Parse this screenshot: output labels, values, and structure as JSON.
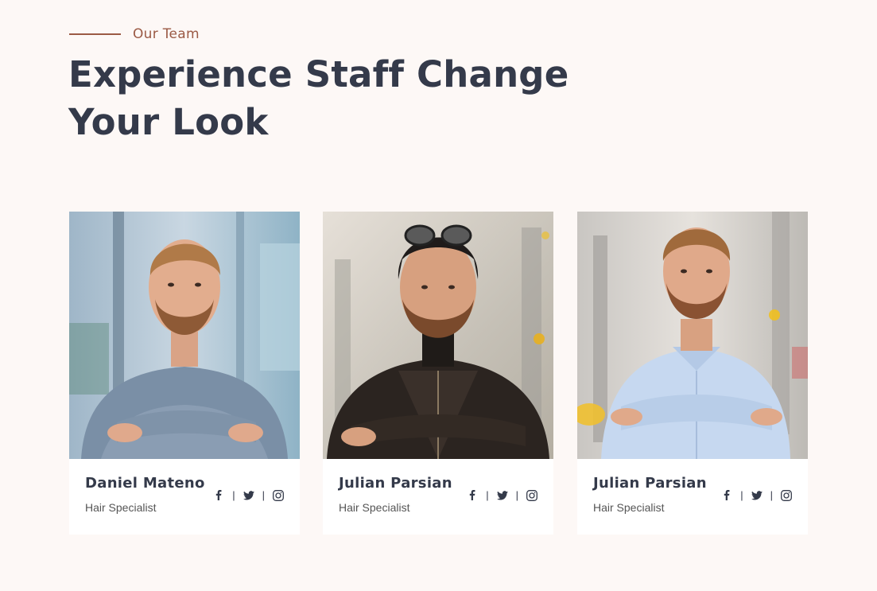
{
  "section": {
    "eyebrow": "Our Team",
    "heading_line1": "Experience Staff Change",
    "heading_line2": "Your Look",
    "accent_color": "#9b5a45"
  },
  "team": [
    {
      "name": "Daniel Mateno",
      "role": "Hair Specialist",
      "photo": "man-grey-sweater-photo"
    },
    {
      "name": "Julian Parsian",
      "role": "Hair Specialist",
      "photo": "man-aviator-jacket-photo"
    },
    {
      "name": "Julian Parsian",
      "role": "Hair Specialist",
      "photo": "man-blue-shirt-photo"
    }
  ],
  "socials": {
    "separator": "|",
    "icons": [
      "facebook-icon",
      "twitter-icon",
      "instagram-icon"
    ]
  }
}
